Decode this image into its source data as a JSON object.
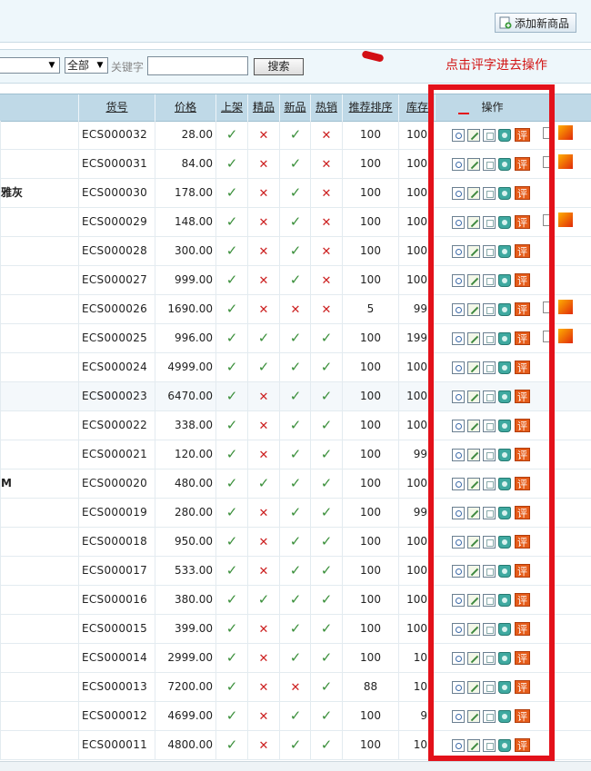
{
  "toolbar": {
    "add_label": "添加新商品"
  },
  "search": {
    "category_select": "",
    "filter_select": "全部",
    "keyword_label": "关键字",
    "keyword_value": "",
    "search_button": "搜索"
  },
  "annotation": {
    "note": "点击评字进去操作"
  },
  "colors": {
    "accent_red": "#e3111a",
    "header_bg": "#bfd9e7",
    "tick": "#3a8f3a",
    "cross": "#cc2020"
  },
  "table": {
    "headers": {
      "sn": "货号",
      "price": "价格",
      "on_sale": "上架",
      "best": "精品",
      "new": "新品",
      "hot": "热销",
      "sort": "推荐排序",
      "stock": "库存",
      "ops": "操作"
    },
    "comment_label": "评",
    "rows": [
      {
        "name": "",
        "sn": "ECS000032",
        "price": "28.00",
        "on_sale": true,
        "best": false,
        "new": true,
        "hot": false,
        "sort": "100",
        "stock": "100",
        "extra": true
      },
      {
        "name": "",
        "sn": "ECS000031",
        "price": "84.00",
        "on_sale": true,
        "best": false,
        "new": true,
        "hot": false,
        "sort": "100",
        "stock": "100",
        "extra": true
      },
      {
        "name": "雅灰",
        "sn": "ECS000030",
        "price": "178.00",
        "on_sale": true,
        "best": false,
        "new": true,
        "hot": false,
        "sort": "100",
        "stock": "100",
        "extra": false
      },
      {
        "name": "",
        "sn": "ECS000029",
        "price": "148.00",
        "on_sale": true,
        "best": false,
        "new": true,
        "hot": false,
        "sort": "100",
        "stock": "100",
        "extra": true
      },
      {
        "name": "",
        "sn": "ECS000028",
        "price": "300.00",
        "on_sale": true,
        "best": false,
        "new": true,
        "hot": false,
        "sort": "100",
        "stock": "100",
        "extra": false
      },
      {
        "name": "",
        "sn": "ECS000027",
        "price": "999.00",
        "on_sale": true,
        "best": false,
        "new": true,
        "hot": false,
        "sort": "100",
        "stock": "100",
        "extra": false
      },
      {
        "name": "",
        "sn": "ECS000026",
        "price": "1690.00",
        "on_sale": true,
        "best": false,
        "new": false,
        "hot": false,
        "sort": "5",
        "stock": "99",
        "extra": true
      },
      {
        "name": "",
        "sn": "ECS000025",
        "price": "996.00",
        "on_sale": true,
        "best": true,
        "new": true,
        "hot": true,
        "sort": "100",
        "stock": "199",
        "extra": true
      },
      {
        "name": "",
        "sn": "ECS000024",
        "price": "4999.00",
        "on_sale": true,
        "best": true,
        "new": true,
        "hot": true,
        "sort": "100",
        "stock": "100",
        "extra": false
      },
      {
        "name": "",
        "sn": "ECS000023",
        "price": "6470.00",
        "on_sale": true,
        "best": false,
        "new": true,
        "hot": true,
        "sort": "100",
        "stock": "100",
        "extra": false
      },
      {
        "name": "",
        "sn": "ECS000022",
        "price": "338.00",
        "on_sale": true,
        "best": false,
        "new": true,
        "hot": true,
        "sort": "100",
        "stock": "100",
        "extra": false
      },
      {
        "name": "",
        "sn": "ECS000021",
        "price": "120.00",
        "on_sale": true,
        "best": false,
        "new": true,
        "hot": true,
        "sort": "100",
        "stock": "99",
        "extra": false
      },
      {
        "name": "M",
        "sn": "ECS000020",
        "price": "480.00",
        "on_sale": true,
        "best": true,
        "new": true,
        "hot": true,
        "sort": "100",
        "stock": "100",
        "extra": false
      },
      {
        "name": "",
        "sn": "ECS000019",
        "price": "280.00",
        "on_sale": true,
        "best": false,
        "new": true,
        "hot": true,
        "sort": "100",
        "stock": "99",
        "extra": false
      },
      {
        "name": "",
        "sn": "ECS000018",
        "price": "950.00",
        "on_sale": true,
        "best": false,
        "new": true,
        "hot": true,
        "sort": "100",
        "stock": "100",
        "extra": false
      },
      {
        "name": "",
        "sn": "ECS000017",
        "price": "533.00",
        "on_sale": true,
        "best": false,
        "new": true,
        "hot": true,
        "sort": "100",
        "stock": "100",
        "extra": false
      },
      {
        "name": "",
        "sn": "ECS000016",
        "price": "380.00",
        "on_sale": true,
        "best": true,
        "new": true,
        "hot": true,
        "sort": "100",
        "stock": "100",
        "extra": false
      },
      {
        "name": "",
        "sn": "ECS000015",
        "price": "399.00",
        "on_sale": true,
        "best": false,
        "new": true,
        "hot": true,
        "sort": "100",
        "stock": "100",
        "extra": false
      },
      {
        "name": "",
        "sn": "ECS000014",
        "price": "2999.00",
        "on_sale": true,
        "best": false,
        "new": true,
        "hot": true,
        "sort": "100",
        "stock": "10",
        "extra": false
      },
      {
        "name": "",
        "sn": "ECS000013",
        "price": "7200.00",
        "on_sale": true,
        "best": false,
        "new": false,
        "hot": true,
        "sort": "88",
        "stock": "10",
        "extra": false
      },
      {
        "name": "",
        "sn": "ECS000012",
        "price": "4699.00",
        "on_sale": true,
        "best": false,
        "new": true,
        "hot": true,
        "sort": "100",
        "stock": "9",
        "extra": false
      },
      {
        "name": "",
        "sn": "ECS000011",
        "price": "4800.00",
        "on_sale": true,
        "best": false,
        "new": true,
        "hot": true,
        "sort": "100",
        "stock": "10",
        "extra": false
      }
    ]
  }
}
